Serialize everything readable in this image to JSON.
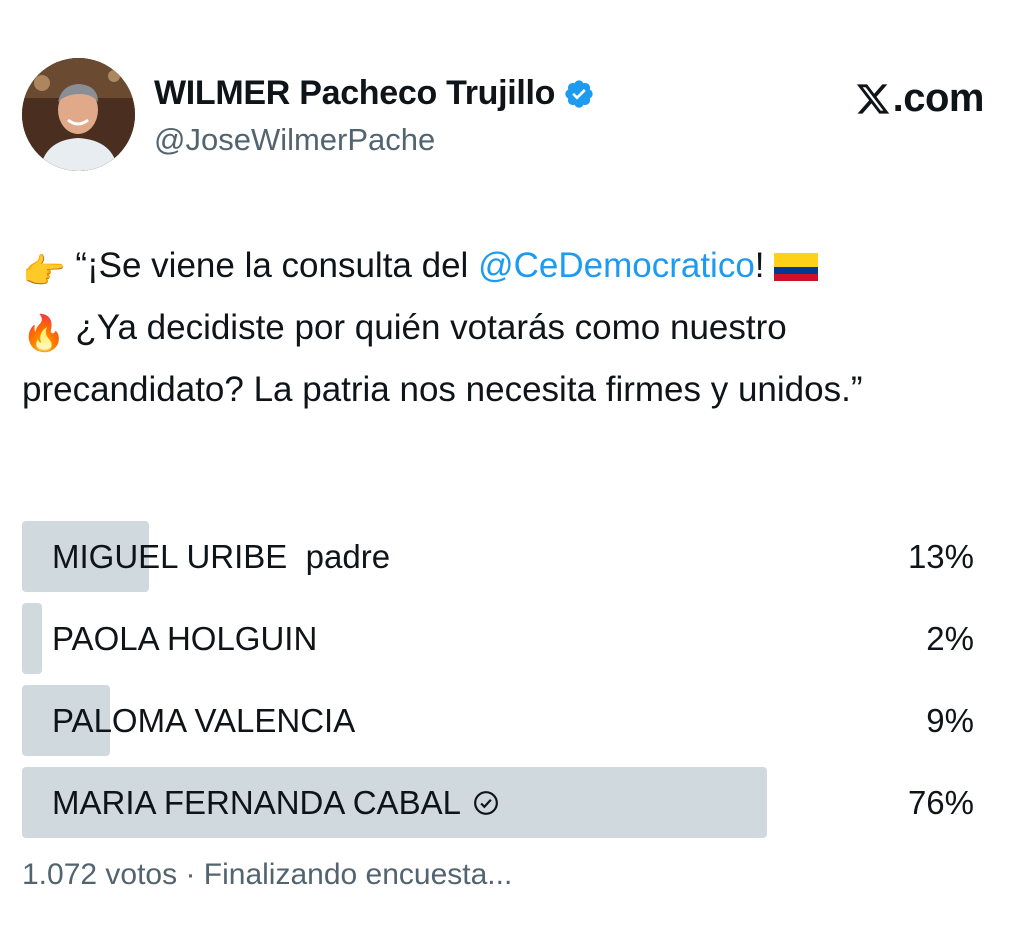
{
  "author": {
    "display_name": "WILMER Pacheco Trujillo",
    "handle": "@JoseWilmerPache",
    "verified": true,
    "avatar_icon": "profile-photo"
  },
  "brand": {
    "logo_text": ".com",
    "logo_icon": "x-logo-icon"
  },
  "tweet": {
    "pointing_emoji": "👉",
    "text_part1": "“¡Se viene la consulta del ",
    "mention": "@CeDemocratico",
    "text_part2": "! ",
    "flag_emoji": "colombia-flag",
    "fire_emoji": "🔥",
    "text_part3": " ¿Ya decidiste por quién votarás como nuestro precandidato? La patria nos necesita firmes y unidos.”"
  },
  "poll": {
    "options": [
      {
        "label": "MIGUEL URIBE  padre",
        "percent": "13%",
        "fraction": 0.13,
        "winner": false
      },
      {
        "label": "PAOLA HOLGUIN",
        "percent": "2%",
        "fraction": 0.02,
        "winner": false
      },
      {
        "label": "PALOMA VALENCIA",
        "percent": "9%",
        "fraction": 0.09,
        "winner": false
      },
      {
        "label": "MARIA FERNANDA CABAL",
        "percent": "76%",
        "fraction": 0.76,
        "winner": true
      }
    ],
    "footer": "1.072 votos · Finalizando encuesta..."
  },
  "colors": {
    "mention": "#1d9bf0",
    "bar": "#cfd9de",
    "secondary_text": "#536471",
    "verified": "#1d9bf0"
  }
}
